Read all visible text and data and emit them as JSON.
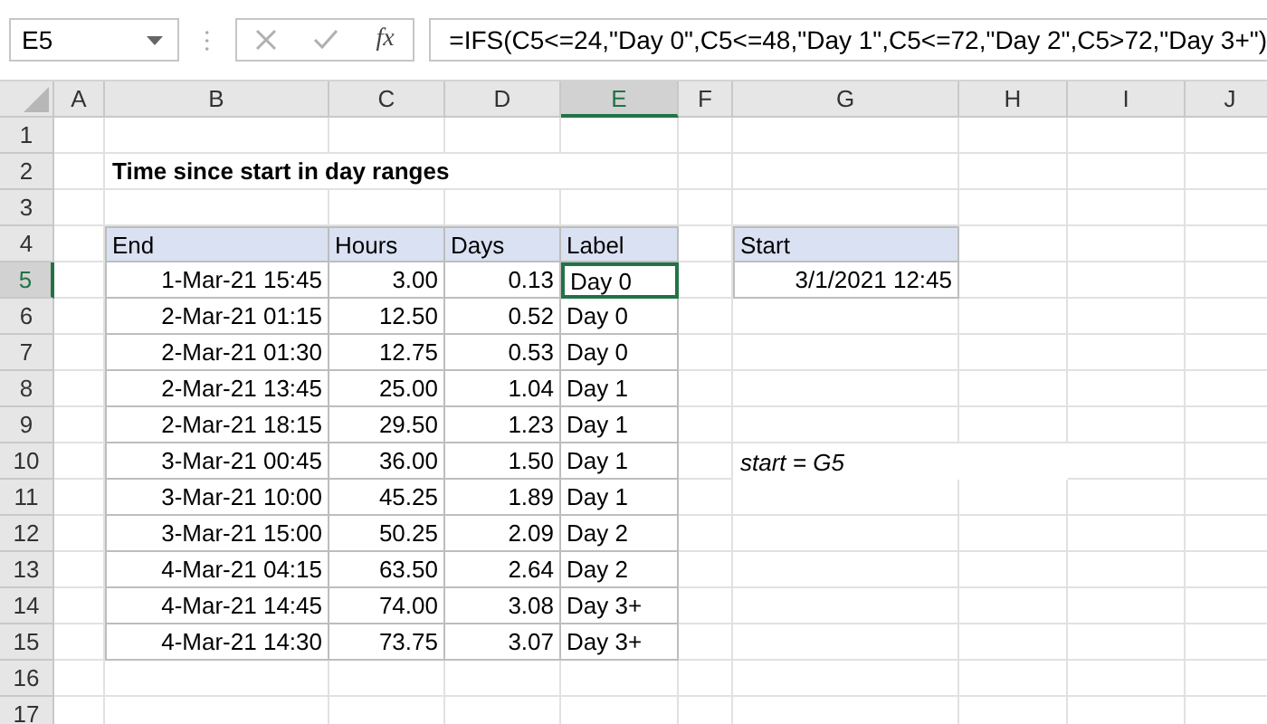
{
  "formula_bar": {
    "name_box": "E5",
    "function_label": "fx",
    "formula": "=IFS(C5<=24,\"Day 0\",C5<=48,\"Day 1\",C5<=72,\"Day 2\",C5>72,\"Day 3+\")"
  },
  "columns": [
    {
      "label": "A",
      "selected": false
    },
    {
      "label": "B",
      "selected": false
    },
    {
      "label": "C",
      "selected": false
    },
    {
      "label": "D",
      "selected": false
    },
    {
      "label": "E",
      "selected": true
    },
    {
      "label": "F",
      "selected": false
    },
    {
      "label": "G",
      "selected": false
    },
    {
      "label": "H",
      "selected": false
    },
    {
      "label": "I",
      "selected": false
    },
    {
      "label": "J",
      "selected": false
    }
  ],
  "rows": [
    {
      "label": "1",
      "selected": false
    },
    {
      "label": "2",
      "selected": false
    },
    {
      "label": "3",
      "selected": false
    },
    {
      "label": "4",
      "selected": false
    },
    {
      "label": "5",
      "selected": true
    },
    {
      "label": "6",
      "selected": false
    },
    {
      "label": "7",
      "selected": false
    },
    {
      "label": "8",
      "selected": false
    },
    {
      "label": "9",
      "selected": false
    },
    {
      "label": "10",
      "selected": false
    },
    {
      "label": "11",
      "selected": false
    },
    {
      "label": "12",
      "selected": false
    },
    {
      "label": "13",
      "selected": false
    },
    {
      "label": "14",
      "selected": false
    },
    {
      "label": "15",
      "selected": false
    },
    {
      "label": "16",
      "selected": false
    },
    {
      "label": "17",
      "selected": false
    }
  ],
  "title": "Time since start in day ranges",
  "table": {
    "columns": [
      "End",
      "Hours",
      "Days",
      "Label"
    ],
    "rows": [
      [
        "1-Mar-21 15:45",
        "3.00",
        "0.13",
        "Day 0"
      ],
      [
        "2-Mar-21 01:15",
        "12.50",
        "0.52",
        "Day 0"
      ],
      [
        "2-Mar-21 01:30",
        "12.75",
        "0.53",
        "Day 0"
      ],
      [
        "2-Mar-21 13:45",
        "25.00",
        "1.04",
        "Day 1"
      ],
      [
        "2-Mar-21 18:15",
        "29.50",
        "1.23",
        "Day 1"
      ],
      [
        "3-Mar-21 00:45",
        "36.00",
        "1.50",
        "Day 1"
      ],
      [
        "3-Mar-21 10:00",
        "45.25",
        "1.89",
        "Day 1"
      ],
      [
        "3-Mar-21 15:00",
        "50.25",
        "2.09",
        "Day 2"
      ],
      [
        "4-Mar-21 04:15",
        "63.50",
        "2.64",
        "Day 2"
      ],
      [
        "4-Mar-21 14:45",
        "74.00",
        "3.08",
        "Day 3+"
      ],
      [
        "4-Mar-21 14:30",
        "73.75",
        "3.07",
        "Day 3+"
      ]
    ]
  },
  "start_table": {
    "header": "Start",
    "value": "3/1/2021 12:45"
  },
  "note": "start = G5"
}
